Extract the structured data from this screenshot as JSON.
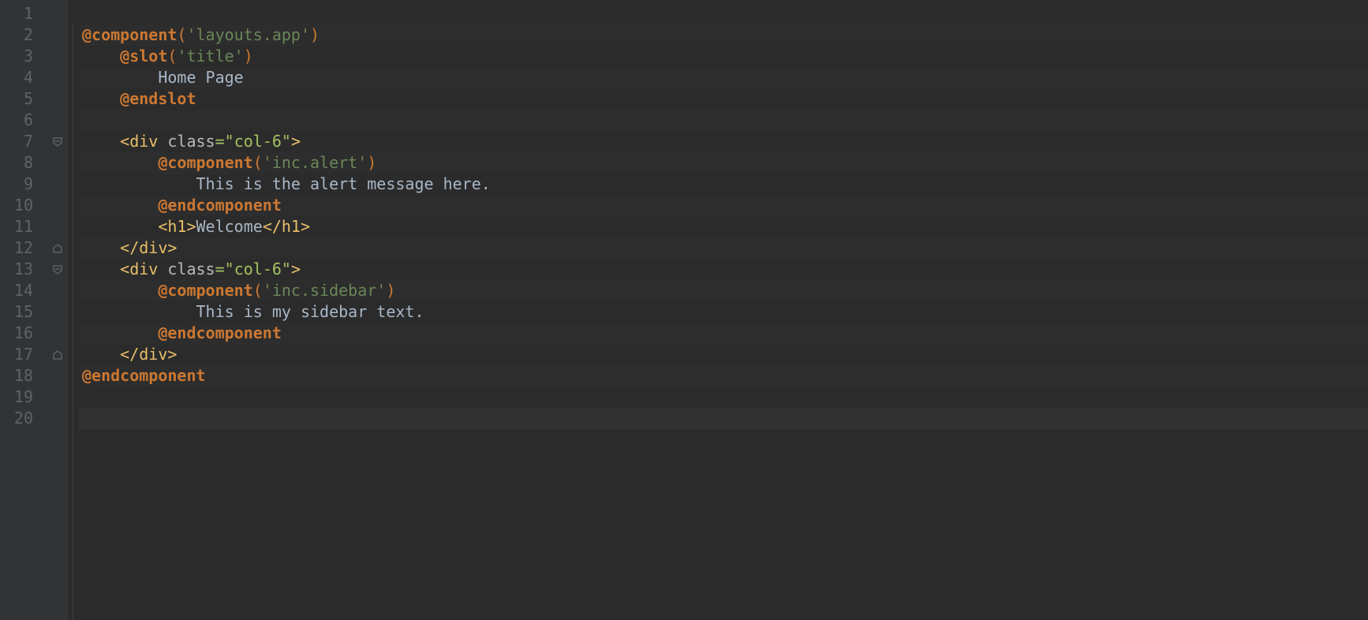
{
  "lineNumbers": [
    "1",
    "2",
    "3",
    "4",
    "5",
    "6",
    "7",
    "8",
    "9",
    "10",
    "11",
    "12",
    "13",
    "14",
    "15",
    "16",
    "17",
    "18",
    "19",
    "20"
  ],
  "fold": {
    "open": {
      "7": true,
      "13": true
    },
    "close": {
      "12": true,
      "17": true
    }
  },
  "tokens": {
    "l2": {
      "dir": "@component",
      "p1": "(",
      "str": "'layouts.app'",
      "p2": ")"
    },
    "l3": {
      "dir": "@slot",
      "p1": "(",
      "str": "'title'",
      "p2": ")"
    },
    "l4": {
      "text": "Home Page"
    },
    "l5": {
      "dir": "@endslot"
    },
    "l7": {
      "open": "<div ",
      "attr": "class",
      "eq": "=",
      "val": "\"col-6\"",
      "close": ">"
    },
    "l8": {
      "dir": "@component",
      "p1": "(",
      "str": "'inc.alert'",
      "p2": ")"
    },
    "l9": {
      "text": "This is the alert message here."
    },
    "l10": {
      "dir": "@endcomponent"
    },
    "l11": {
      "open": "<h1>",
      "text": "Welcome",
      "close": "</h1>"
    },
    "l12": {
      "close": "</div>"
    },
    "l13": {
      "open": "<div ",
      "attr": "class",
      "eq": "=",
      "val": "\"col-6\"",
      "close": ">"
    },
    "l14": {
      "dir": "@component",
      "p1": "(",
      "str": "'inc.sidebar'",
      "p2": ")"
    },
    "l15": {
      "text": "This is my sidebar text."
    },
    "l16": {
      "dir": "@endcomponent"
    },
    "l17": {
      "close": "</div>"
    },
    "l18": {
      "dir": "@endcomponent"
    }
  },
  "indent": {
    "unit": "    ",
    "l2": 0,
    "l3": 1,
    "l4": 2,
    "l5": 1,
    "l7": 1,
    "l8": 2,
    "l9": 3,
    "l10": 2,
    "l11": 2,
    "l12": 1,
    "l13": 1,
    "l14": 2,
    "l15": 3,
    "l16": 2,
    "l17": 1,
    "l18": 0
  }
}
